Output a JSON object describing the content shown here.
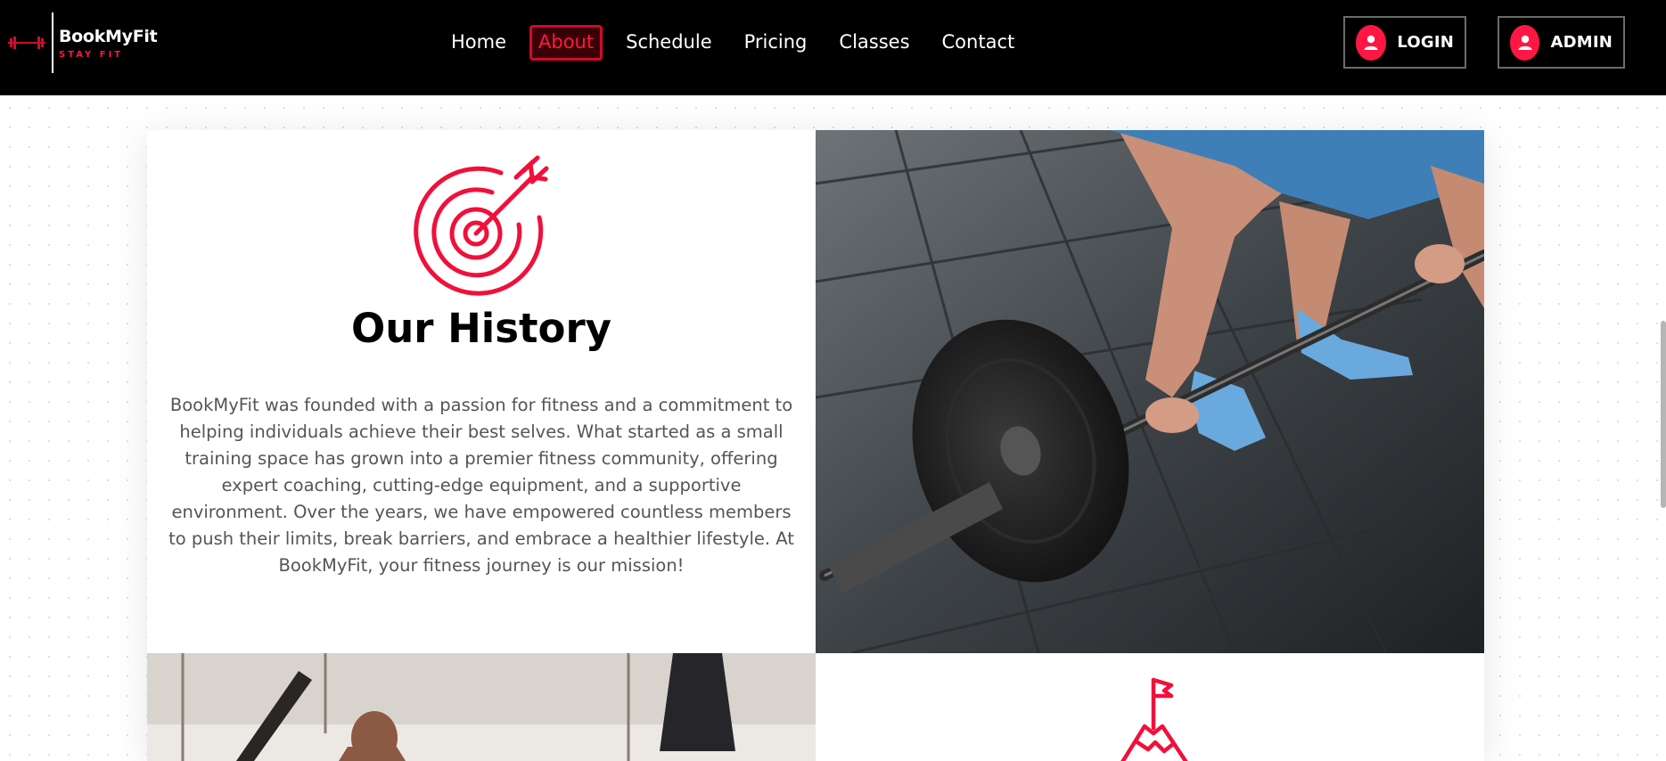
{
  "brand": {
    "name": "BookMyFit",
    "tagline": "STAY FIT",
    "logo_icon": "dumbbell-icon",
    "accent": "#ff1744"
  },
  "nav": {
    "links": [
      {
        "label": "Home",
        "active": false
      },
      {
        "label": "About",
        "active": true
      },
      {
        "label": "Schedule",
        "active": false
      },
      {
        "label": "Pricing",
        "active": false
      },
      {
        "label": "Classes",
        "active": false
      },
      {
        "label": "Contact",
        "active": false
      }
    ],
    "login_label": "LOGIN",
    "admin_label": "ADMIN",
    "user_icon": "user-icon"
  },
  "history": {
    "icon": "target-arrow-icon",
    "title": "Our History",
    "text": "BookMyFit was founded with a passion for fitness and a commitment to helping individuals achieve their best selves. What started as a small training space has grown into a premier fitness community, offering expert coaching, cutting-edge equipment, and a supportive environment. Over the years, we have empowered countless members to push their limits, break barriers, and embrace a healthier lifestyle. At BookMyFit, your fitness journey is our mission!"
  },
  "goal_section": {
    "icon": "mountain-flag-icon"
  },
  "colors": {
    "navbar": "#000000",
    "accent": "#ff1744",
    "body_text": "#555555"
  }
}
